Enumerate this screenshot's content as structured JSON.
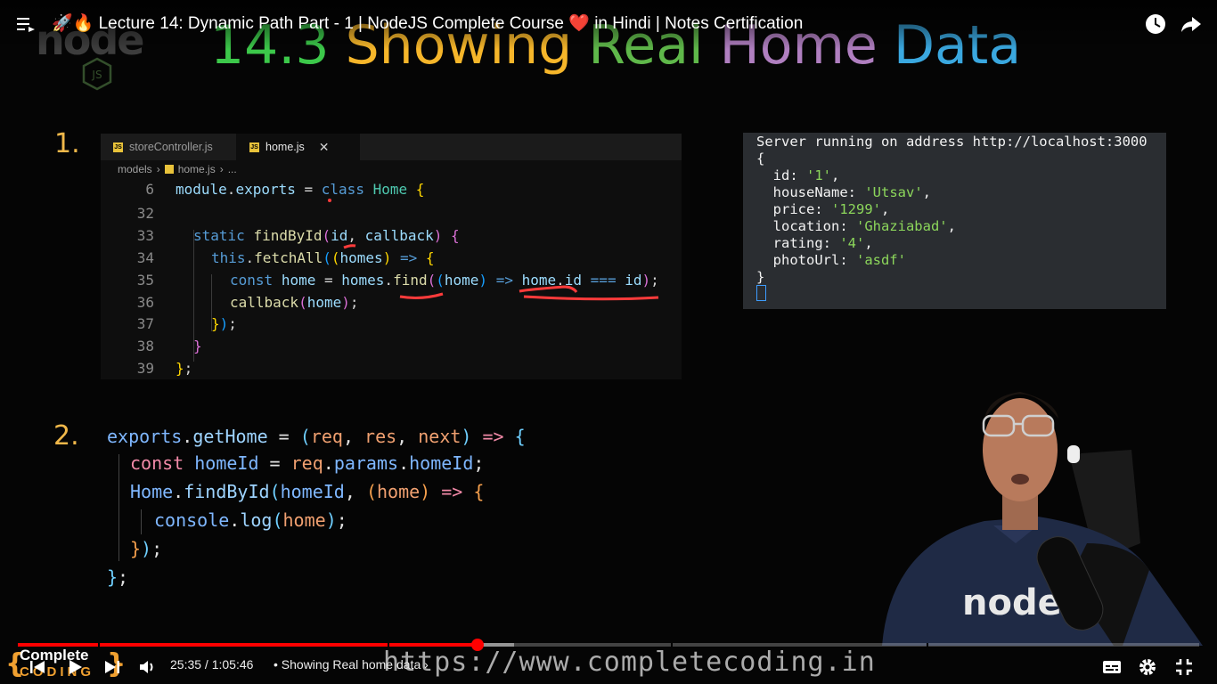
{
  "player": {
    "title": "🚀🔥 Lecture 14: Dynamic Path Part - 1 | NodeJS Complete Course ❤️ in Hindi | Notes Certification",
    "time_current": "25:35",
    "time_total": "1:05:46",
    "time_display": "25:35 / 1:05:46",
    "chapter": "• Showing Real home data",
    "chapter_chevron": "›",
    "progress_fraction": 0.389,
    "buffered_fraction": 0.42,
    "accent_color": "#ff0000"
  },
  "logo": {
    "node_word": "node",
    "js_badge": "JS"
  },
  "slide": {
    "title_parts": [
      {
        "text": "14.3",
        "color": "#3cc84a"
      },
      {
        "text": "Showing",
        "color": "#f6b62a"
      },
      {
        "text": "Real",
        "color": "#5fb84a"
      },
      {
        "text": "Home",
        "color": "#b07fc0"
      },
      {
        "text": "Data",
        "color": "#3aa8e0"
      }
    ],
    "step1": "1.",
    "step2": "2."
  },
  "editor": {
    "tabs": [
      {
        "label": "storeController.js",
        "active": false
      },
      {
        "label": "home.js",
        "active": true
      }
    ],
    "breadcrumb": [
      "models",
      "›",
      "home.js",
      "›",
      "..."
    ],
    "line_numbers": [
      "6",
      "32",
      "33",
      "34",
      "35",
      "36",
      "37",
      "38",
      "39"
    ]
  },
  "terminal": {
    "lines": [
      "Server running on address http://localhost:3000",
      "{",
      "  id: ",
      "  houseName: ",
      "  price: ",
      "  location: ",
      "  rating: ",
      "  photoUrl: ",
      "}"
    ],
    "values": {
      "id": "'1'",
      "houseName": "'Utsav'",
      "price": "'1299'",
      "location": "'Ghaziabad'",
      "rating": "'4'",
      "photoUrl": "'asdf'"
    }
  },
  "watermark": {
    "url": "https://www.completecoding.in"
  },
  "channel": {
    "line1": "Complete",
    "line2": "CODING"
  }
}
